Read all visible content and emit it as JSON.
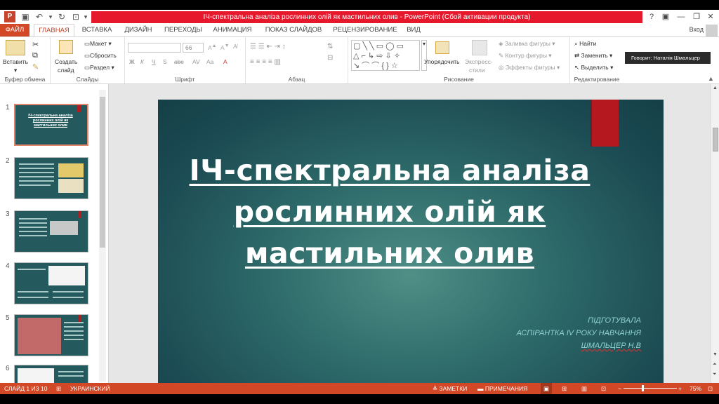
{
  "window": {
    "title": "ІЧ-спектральна аналіза рослинних олій як мастильних олив - PowerPoint (Сбой активации продукта)",
    "app_logo": "P",
    "help_icon": "?"
  },
  "tabs": [
    "ФАЙЛ",
    "ГЛАВНАЯ",
    "ВСТАВКА",
    "ДИЗАЙН",
    "ПЕРЕХОДЫ",
    "АНИМАЦИЯ",
    "ПОКАЗ СЛАЙДОВ",
    "РЕЦЕНЗИРОВАНИЕ",
    "ВИД"
  ],
  "active_tab": "ГЛАВНАЯ",
  "signin": "Вход",
  "ribbon": {
    "clipboard": {
      "paste": "Вставить",
      "label": "Буфер обмена"
    },
    "slides": {
      "create": "Создать",
      "create2": "слайд",
      "layout": "Макет",
      "reset": "Сбросить",
      "section": "Раздел",
      "label": "Слайды"
    },
    "font": {
      "size": "66",
      "bold": "Ж",
      "italic": "К",
      "underline": "Ч",
      "strike": "S",
      "spacing": "abc",
      "label": "Шрифт"
    },
    "paragraph": {
      "label": "Абзац"
    },
    "drawing": {
      "arrange": "Упорядочить",
      "styles1": "Экспресс-",
      "styles2": "стили",
      "fill": "Заливка фигуры",
      "outline": "Контур фигуры",
      "effects": "Эффекты фигуры",
      "label": "Рисование"
    },
    "editing": {
      "find": "Найти",
      "replace": "Заменить",
      "select": "Выделить",
      "label": "Редактирование"
    }
  },
  "tooltip": "Говорит: Наталія Шмальцер",
  "thumbnails": [
    {
      "num": "1",
      "title": "ІЧ-спектральна аналіза рослинних олій як мастильних олив"
    },
    {
      "num": "2"
    },
    {
      "num": "3"
    },
    {
      "num": "4"
    },
    {
      "num": "5"
    },
    {
      "num": "6"
    }
  ],
  "slide": {
    "title": "ІЧ-спектральна аналіза рослинних олій як мастильних олив",
    "subtitle": [
      "ПІДГОТУВАЛА",
      "АСПІРАНТКА IV РОКУ НАВЧАННЯ",
      "ШМАЛЬЦЕР Н.В"
    ]
  },
  "statusbar": {
    "slide_info": "СЛАЙД 1 ИЗ 10",
    "language": "УКРАИНСКИЙ",
    "notes": "ЗАМЕТКИ",
    "comments": "ПРИМЕЧАНИЯ",
    "zoom_minus": "−",
    "zoom_plus": "+",
    "zoom": "75%"
  },
  "colors": {
    "accent": "#d24726",
    "title_red": "#e6182c",
    "slide_bg": "#1f4f55",
    "flag": "#b5191f"
  }
}
